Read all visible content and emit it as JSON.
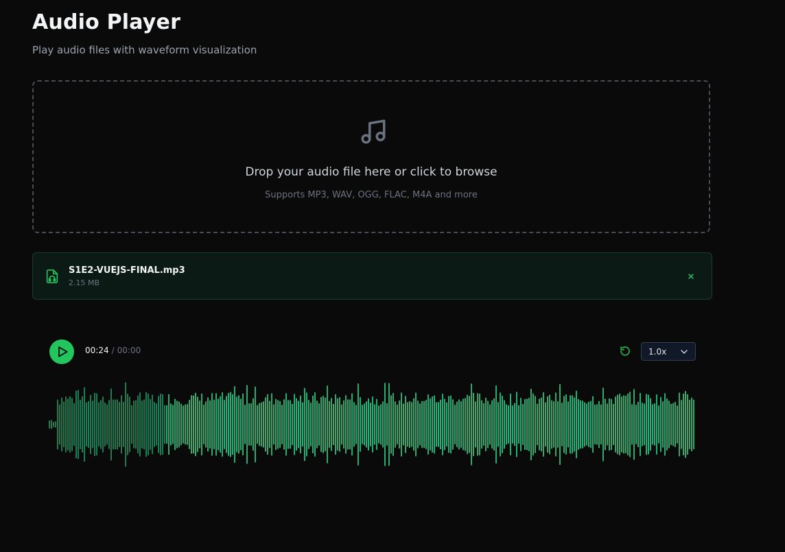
{
  "header": {
    "title": "Audio Player",
    "subtitle": "Play audio files with waveform visualization"
  },
  "dropzone": {
    "icon": "music-note-icon",
    "title": "Drop your audio file here or click to browse",
    "hint": "Supports MP3, WAV, OGG, FLAC, M4A and more"
  },
  "file": {
    "icon": "file-audio-icon",
    "name": "S1E2-VUEJS-FINAL.mp3",
    "size": "2.15 MB",
    "remove_icon": "close-icon"
  },
  "player": {
    "current_time": "00:24",
    "separator": "/",
    "duration": "00:00",
    "speed": "1.0x",
    "play_icon": "play-icon",
    "restart_icon": "restart-icon"
  },
  "colors": {
    "background": "#0a0a0a",
    "accent": "#22c55e",
    "waveform": "#2fbf7e",
    "waveform_played": "#1f8a5c",
    "file_card_bg": "#0c1a15"
  }
}
